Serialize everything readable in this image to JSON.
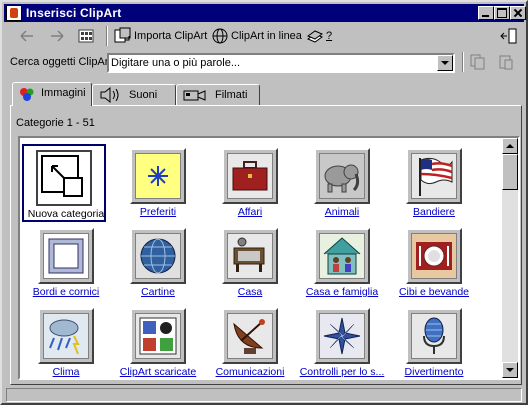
{
  "window": {
    "title": "Inserisci ClipArt"
  },
  "toolbar": {
    "import_label": "Importa ClipArt",
    "online_label": "ClipArt in linea",
    "help_label": "?"
  },
  "search": {
    "label": "Cerca oggetti ClipArt:",
    "value": "Digitare una o più parole..."
  },
  "tabs": [
    {
      "label": "Immagini",
      "active": true
    },
    {
      "label": "Suoni",
      "active": false
    },
    {
      "label": "Filmati",
      "active": false
    }
  ],
  "category_count": "Categorie 1 - 51",
  "categories": [
    {
      "label": "Nuova categoria",
      "icon": "new-category-icon"
    },
    {
      "label": "Preferiti",
      "icon": "favorites-star-icon"
    },
    {
      "label": "Affari",
      "icon": "briefcase-icon"
    },
    {
      "label": "Animali",
      "icon": "elephant-icon"
    },
    {
      "label": "Bandiere",
      "icon": "flag-icon"
    },
    {
      "label": "Bordi e cornici",
      "icon": "frame-icon"
    },
    {
      "label": "Cartine",
      "icon": "globe-icon"
    },
    {
      "label": "Casa",
      "icon": "home-icon"
    },
    {
      "label": "Casa e famiglia",
      "icon": "family-house-icon"
    },
    {
      "label": "Cibi e bevande",
      "icon": "plate-icon"
    },
    {
      "label": "Clima",
      "icon": "weather-icon"
    },
    {
      "label": "ClipArt scaricate",
      "icon": "downloaded-clipart-icon"
    },
    {
      "label": "Comunicazioni",
      "icon": "satellite-dish-icon"
    },
    {
      "label": "Controlli per lo s...",
      "icon": "compass-star-icon"
    },
    {
      "label": "Divertimento",
      "icon": "microphone-icon"
    }
  ],
  "colors": {
    "title_bar": "#00007b",
    "link": "#0000c8",
    "face": "#c0c0c0"
  }
}
